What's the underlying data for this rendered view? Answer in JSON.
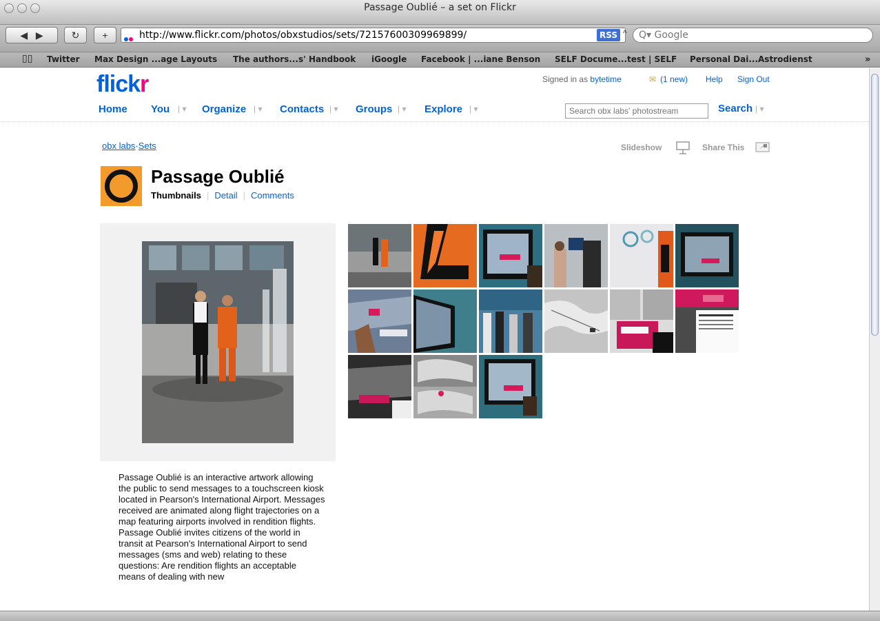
{
  "browser": {
    "window_title": "Passage Oublié – a set on Flickr",
    "url": "http://www.flickr.com/photos/obxstudios/sets/72157600309969899/",
    "rss_label": "RSS",
    "search_placeholder": "Google",
    "bookmarks": [
      "Twitter",
      "Max Design ...age Layouts",
      "The authors...s' Handbook",
      "iGoogle",
      "Facebook | ...iane Benson",
      "SELF Docume...test | SELF",
      "Personal Dai...Astrodienst"
    ],
    "bookmarks_overflow": "»"
  },
  "header": {
    "logo_main": "flickr",
    "logo_mark": "·",
    "signed_in_prefix": "Signed in as",
    "username": "bytetime",
    "mail_new": "(1 new)",
    "help": "Help",
    "sign_out": "Sign Out",
    "nav": [
      "Home",
      "You",
      "Organize",
      "Contacts",
      "Groups",
      "Explore"
    ],
    "search_placeholder": "Search obx labs' photostream",
    "search_button": "Search"
  },
  "set": {
    "breadcrumb_owner": "obx labs",
    "breadcrumb_sep": "·",
    "breadcrumb_sets": "Sets",
    "slideshow": "Slideshow",
    "share": "Share This",
    "title": "Passage Oublié",
    "tabs": [
      "Thumbnails",
      "Detail",
      "Comments"
    ],
    "description_1": "Passage Oublié is an interactive artwork allowing the public to send messages to a touchscreen kiosk located in Pearson's International Airport. Messages received are animated along flight trajectories on a map featuring airports involved in rendition flights.",
    "description_2": "Passage Oublié invites citizens of the world in transit at Pearson's International Airport to send messages (sms and web) relating to these questions: Are rendition flights an acceptable means of dealing with new"
  },
  "thumb_count": 15,
  "colors": {
    "flickr_blue": "#0063dc",
    "flickr_pink": "#ff0084",
    "set_icon": "#f39a2d"
  }
}
